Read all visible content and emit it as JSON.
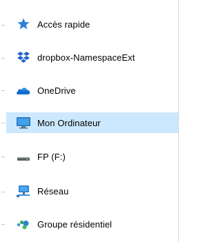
{
  "nav": {
    "items": [
      {
        "label": "Accès rapide",
        "icon": "star-pin-icon",
        "selected": false
      },
      {
        "label": "dropbox-NamespaceExt",
        "icon": "dropbox-icon",
        "selected": false
      },
      {
        "label": "OneDrive",
        "icon": "onedrive-cloud-icon",
        "selected": false
      },
      {
        "label": "Mon Ordinateur",
        "icon": "computer-monitor-icon",
        "selected": true
      },
      {
        "label": "FP (F:)",
        "icon": "drive-icon",
        "selected": false
      },
      {
        "label": "Réseau",
        "icon": "network-icon",
        "selected": false
      },
      {
        "label": "Groupe résidentiel",
        "icon": "homegroup-icon",
        "selected": false
      }
    ]
  },
  "colors": {
    "selection": "#cce8ff",
    "accent": "#1e6fd0"
  }
}
